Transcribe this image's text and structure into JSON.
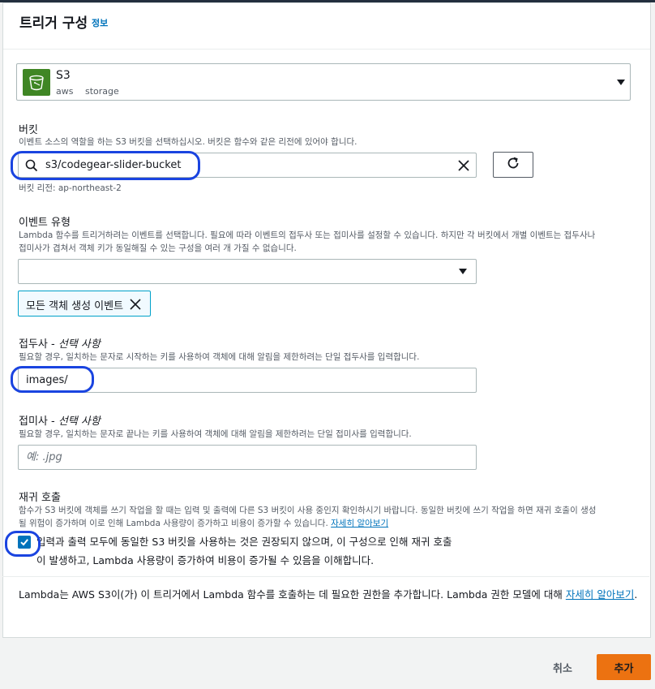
{
  "header": {
    "title": "트리거 구성",
    "info_link": "정보"
  },
  "source": {
    "name": "S3",
    "tags": [
      "aws",
      "storage"
    ],
    "icon": "s3-bucket-icon",
    "icon_color": "#3f8624"
  },
  "bucket": {
    "label": "버킷",
    "description": "이벤트 소스의 역할을 하는 S3 버킷을 선택하십시오. 버킷은 함수와 같은 리전에 있어야 합니다.",
    "value": "s3/codegear-slider-bucket",
    "region_note": "버킷 리전: ap-northeast-2"
  },
  "event_type": {
    "label": "이벤트 유형",
    "description_1": "Lambda 함수를 트리거하려는 이벤트를 선택합니다. 필요에 따라 이벤트의 접두사 또는 접미사를 설정할 수 있습니다. 하지만 각 버킷에서 개별 이벤트는 접두사나",
    "description_2": "접미사가 겹쳐서 객체 키가 동일해질 수 있는 구성을 여러 개 가질 수 없습니다.",
    "selected_token": "모든 객체 생성 이벤트"
  },
  "prefix": {
    "label": "접두사 - ",
    "label_optional": "선택 사항",
    "description": "필요할 경우, 일치하는 문자로 시작하는 키를 사용하여 객체에 대해 알림을 제한하려는 단일 접두사를 입력합니다.",
    "value": "images/"
  },
  "suffix": {
    "label": "접미사 - ",
    "label_optional": "선택 사항",
    "description": "필요할 경우, 일치하는 문자로 끝나는 키를 사용하여 객체에 대해 알림을 제한하려는 단일 접미사를 입력합니다.",
    "placeholder": "예: .jpg"
  },
  "recursive": {
    "label": "재귀 호출",
    "description_1": "함수가 S3 버킷에 객체를 쓰기 작업을 할 때는 입력 및 출력에 다른 S3 버킷이 사용 중인지 확인하시기 바랍니다. 동일한 버킷에 쓰기 작업을 하면 재귀 호출이 생성",
    "description_2": "될 위험이 증가하며 이로 인해 Lambda 사용량이 증가하고 비용이 증가할 수 있습니다.",
    "learn_more": "자세히 알아보기",
    "ack_line_1": "입력과 출력 모두에 동일한 S3 버킷을 사용하는 것은 권장되지 않으며, 이 구성으로 인해 재귀 호출",
    "ack_line_2": "이 발생하고, Lambda 사용량이 증가하여 비용이 증가될 수 있음을 이해합니다.",
    "checked": true
  },
  "permission_note": {
    "text": "Lambda는 AWS S3이(가) 이 트리거에서 Lambda 함수를 호출하는 데 필요한 권한을 추가합니다. Lambda 권한 모델에 대해 ",
    "link": "자세히 알아보기",
    "end": "."
  },
  "actions": {
    "cancel": "취소",
    "add": "추가"
  },
  "colors": {
    "accent": "#ec7211",
    "link": "#0073bb",
    "highlight": "#1a44e0"
  }
}
